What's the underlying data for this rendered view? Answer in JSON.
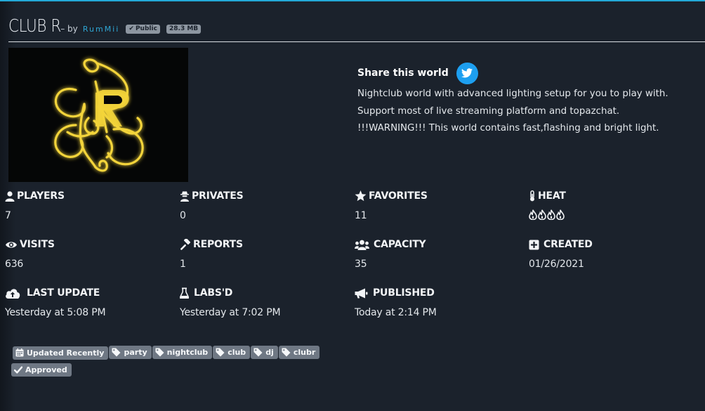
{
  "world": {
    "title": "CLUB R",
    "by_text": "– by",
    "author": "RumMii",
    "public_badge": "Public",
    "size_badge": "28.3 MB"
  },
  "share": {
    "title": "Share this world",
    "description": "Nightclub world with advanced lighting setup for you to play with. Support most of live streaming platform and topazchat. !!!WARNING!!! This world contains fast,flashing and bright light."
  },
  "stats": {
    "players": {
      "label": "PLAYERS",
      "value": "7",
      "icon": "user-icon"
    },
    "privates": {
      "label": "PRIVATES",
      "value": "0",
      "icon": "user-secret-icon"
    },
    "favorites": {
      "label": "FAVORITES",
      "value": "11",
      "icon": "star-icon"
    },
    "heat": {
      "label": "HEAT",
      "value": "4 of 4",
      "level": 4,
      "icon": "thermometer-icon",
      "flame_icon": "fire-icon"
    },
    "visits": {
      "label": "VISITS",
      "value": "636",
      "icon": "eye-icon"
    },
    "reports": {
      "label": "REPORTS",
      "value": "1",
      "icon": "gavel-icon"
    },
    "capacity": {
      "label": "CAPACITY",
      "value": "35",
      "icon": "users-icon"
    },
    "created": {
      "label": "CREATED",
      "value": "01/26/2021",
      "icon": "plus-square-icon"
    },
    "last_update": {
      "label": "LAST UPDATE",
      "value": "Yesterday at 5:08 PM",
      "icon": "cloud-upload-icon"
    },
    "labs": {
      "label": "LABS'D",
      "value": "Yesterday at 7:02 PM",
      "icon": "flask-icon"
    },
    "published": {
      "label": "PUBLISHED",
      "value": "Today at 2:14 PM",
      "icon": "megaphone-icon"
    }
  },
  "tags": [
    {
      "label": "Updated Recently",
      "icon": "calendar-icon"
    },
    {
      "label": "party",
      "icon": "tag-icon"
    },
    {
      "label": "nightclub",
      "icon": "tag-icon"
    },
    {
      "label": "club",
      "icon": "tag-icon"
    },
    {
      "label": "dj",
      "icon": "tag-icon"
    },
    {
      "label": "clubr",
      "icon": "tag-icon"
    },
    {
      "label": "Approved",
      "icon": "check-icon"
    }
  ],
  "colors": {
    "background": "#1b222c",
    "accent": "#23a9d8",
    "twitter": "#1d9ff0",
    "tag_bg": "#6f7884",
    "logo_gold": "#f3d43a"
  }
}
